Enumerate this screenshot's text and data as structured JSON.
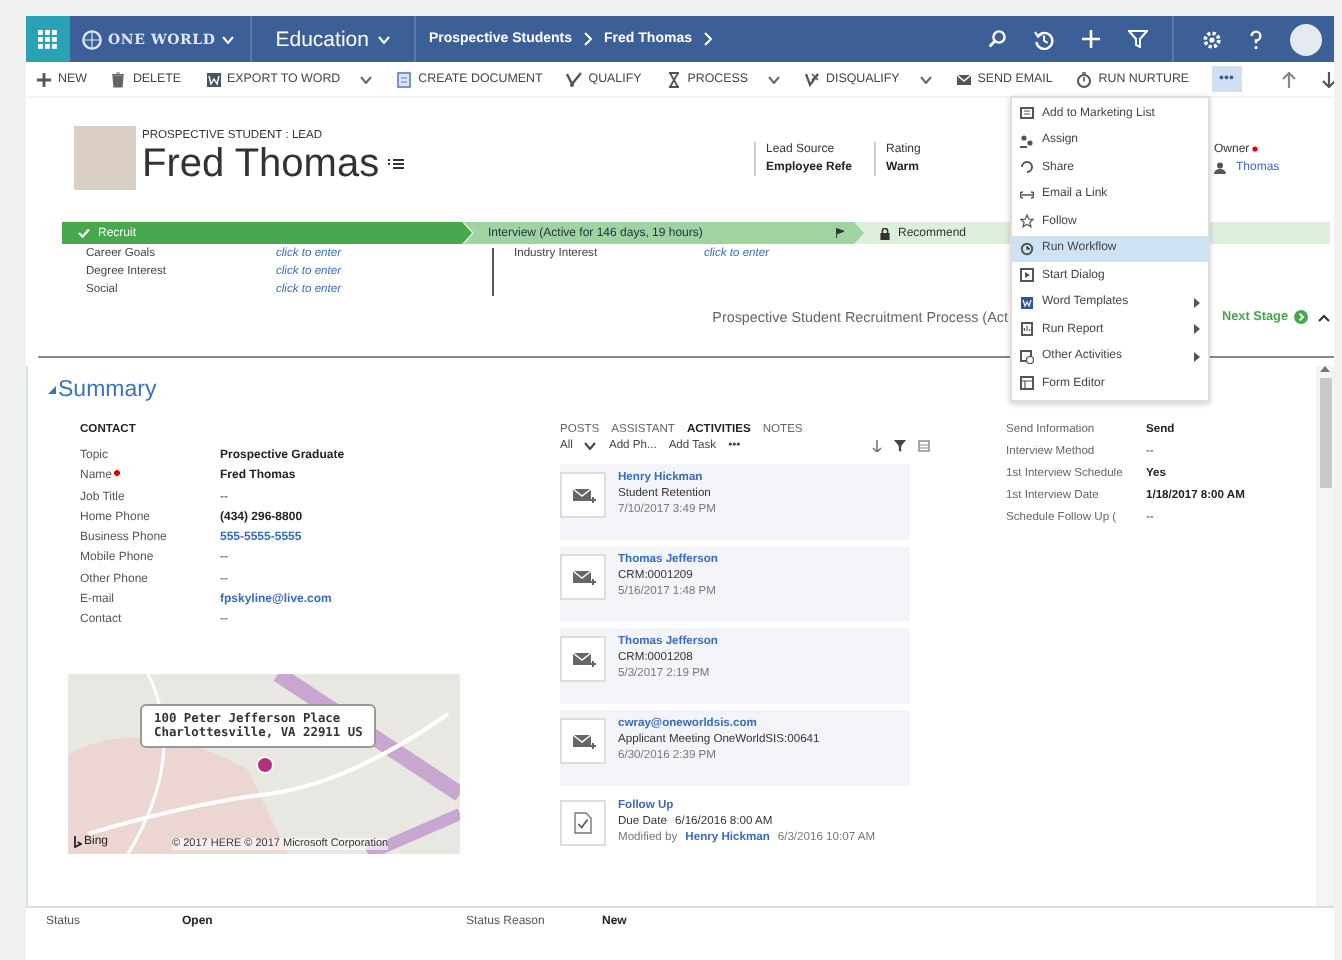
{
  "nav": {
    "logo": "ONE WORLD",
    "area": "Education",
    "breadcrumbs": [
      "Prospective Students",
      "Fred Thomas"
    ]
  },
  "commands": [
    {
      "label": "NEW",
      "dropdown": false
    },
    {
      "label": "DELETE",
      "dropdown": false
    },
    {
      "label": "EXPORT TO WORD",
      "dropdown": true
    },
    {
      "label": "CREATE DOCUMENT",
      "dropdown": false
    },
    {
      "label": "QUALIFY",
      "dropdown": false
    },
    {
      "label": "PROCESS",
      "dropdown": true
    },
    {
      "label": "DISQUALIFY",
      "dropdown": true
    },
    {
      "label": "SEND EMAIL",
      "dropdown": false
    },
    {
      "label": "RUN NURTURE",
      "dropdown": false
    }
  ],
  "more": {
    "label": "•••",
    "selected": true
  },
  "header": {
    "entity": "PROSPECTIVE STUDENT : LEAD",
    "name": "Fred Thomas",
    "fields": [
      {
        "label": "Lead Source",
        "value": "Employee Refe"
      },
      {
        "label": "Rating",
        "value": "Warm"
      }
    ],
    "owner": {
      "label": "Owner",
      "value": "Thomas",
      "required": true
    }
  },
  "process": {
    "stages": [
      {
        "label": "Recruit",
        "completed": true,
        "active": false,
        "locked": false
      },
      {
        "label": "Interview (Active for 146 days, 19 hours)",
        "completed": false,
        "active": true,
        "locked": false
      },
      {
        "label": "Recommend",
        "completed": false,
        "active": false,
        "locked": true
      }
    ],
    "fields_left": [
      {
        "label": "Career Goals",
        "value": "click to enter"
      },
      {
        "label": "Degree Interest",
        "value": "click to enter"
      },
      {
        "label": "Social",
        "value": "click to enter"
      }
    ],
    "fields_right": [
      {
        "label": "Industry Interest",
        "value": "click to enter"
      }
    ],
    "name": "Prospective Student Recruitment Process (Act",
    "next_stage": "Next Stage"
  },
  "menu": [
    {
      "label": "Add to Marketing List",
      "submenu": false,
      "selected": false
    },
    {
      "label": "Assign",
      "submenu": false,
      "selected": false
    },
    {
      "label": "Share",
      "submenu": false,
      "selected": false
    },
    {
      "label": "Email a Link",
      "submenu": false,
      "selected": false
    },
    {
      "label": "Follow",
      "submenu": false,
      "selected": false
    },
    {
      "label": "Run Workflow",
      "submenu": false,
      "selected": true
    },
    {
      "label": "Start Dialog",
      "submenu": false,
      "selected": false
    },
    {
      "label": "Word Templates",
      "submenu": true,
      "selected": false
    },
    {
      "label": "Run Report",
      "submenu": true,
      "selected": false
    },
    {
      "label": "Other Activities",
      "submenu": true,
      "selected": false
    },
    {
      "label": "Form Editor",
      "submenu": false,
      "selected": false
    }
  ],
  "summary": {
    "title": "Summary",
    "contact": {
      "heading": "CONTACT",
      "rows": [
        {
          "label": "Topic",
          "value": "Prospective Graduate",
          "kind": "bold",
          "required": false
        },
        {
          "label": "Name",
          "value": "Fred Thomas",
          "kind": "bold",
          "required": true
        },
        {
          "label": "Job Title",
          "value": "--",
          "kind": "text",
          "required": false
        },
        {
          "label": "Home Phone",
          "value": "(434) 296-8800",
          "kind": "bold",
          "required": false
        },
        {
          "label": "Business Phone",
          "value": "555-5555-5555",
          "kind": "link",
          "required": false
        },
        {
          "label": "Mobile Phone",
          "value": "--",
          "kind": "text",
          "required": false
        },
        {
          "label": "Other Phone",
          "value": "--",
          "kind": "text",
          "required": false
        },
        {
          "label": "E-mail",
          "value": "fpskyline@live.com",
          "kind": "link",
          "required": false
        },
        {
          "label": "Contact",
          "value": "--",
          "kind": "text",
          "required": false
        }
      ]
    },
    "map": {
      "address": [
        "100 Peter Jefferson Place",
        "Charlottesville, VA 22911 US"
      ],
      "brand": "Bing",
      "copyright": "© 2017 HERE © 2017 Microsoft Corporation"
    },
    "social": {
      "tabs": [
        {
          "label": "POSTS",
          "selected": false
        },
        {
          "label": "ASSISTANT",
          "selected": false
        },
        {
          "label": "ACTIVITIES",
          "selected": true
        },
        {
          "label": "NOTES",
          "selected": false
        }
      ],
      "toolbar": [
        "All",
        "Add Ph...",
        "Add Task",
        "•••"
      ],
      "activities": [
        {
          "kind": "email",
          "title": "Henry Hickman",
          "subject": "Student Retention",
          "date": "7/10/2017 3:49 PM"
        },
        {
          "kind": "email",
          "title": "Thomas Jefferson",
          "subject": "CRM:0001209",
          "date": "5/16/2017 1:48 PM"
        },
        {
          "kind": "email",
          "title": "Thomas Jefferson",
          "subject": "CRM:0001208",
          "date": "5/3/2017 2:19 PM"
        },
        {
          "kind": "email",
          "title": "cwray@oneworldsis.com",
          "subject": "Applicant Meeting OneWorldSIS:00641",
          "date": "6/30/2016 2:39 PM"
        },
        {
          "kind": "task",
          "title": "Follow Up",
          "due_label": "Due Date",
          "due": "6/16/2016 8:00 AM",
          "modified_label": "Modified by",
          "modified_by": "Henry Hickman",
          "date": "6/3/2016 10:07 AM"
        }
      ]
    },
    "details": [
      {
        "label": "Send Information",
        "value": "Send",
        "kind": "bold"
      },
      {
        "label": "Interview Method",
        "value": "--",
        "kind": "text"
      },
      {
        "label": "1st Interview Schedule",
        "value": "Yes",
        "kind": "bold"
      },
      {
        "label": "1st Interview Date",
        "value": "1/18/2017  8:00 AM",
        "kind": "bold"
      },
      {
        "label": "Schedule Follow Up (",
        "value": "--",
        "kind": "text"
      }
    ]
  },
  "status": [
    {
      "label": "Status",
      "value": "Open"
    },
    {
      "label": "Status Reason",
      "value": "New"
    }
  ]
}
